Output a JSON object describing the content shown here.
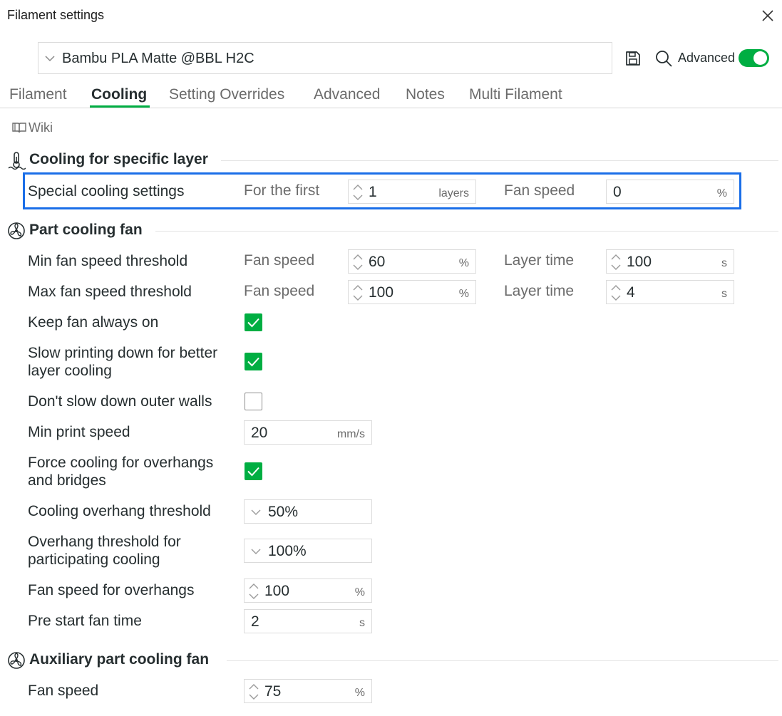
{
  "window": {
    "title": "Filament settings"
  },
  "preset": {
    "name": "Bambu PLA Matte @BBL H2C"
  },
  "toolbar": {
    "advanced_label": "Advanced",
    "advanced_on": true
  },
  "tabs": [
    {
      "label": "Filament",
      "active": false
    },
    {
      "label": "Cooling",
      "active": true
    },
    {
      "label": "Setting Overrides",
      "active": false
    },
    {
      "label": "Advanced",
      "active": false
    },
    {
      "label": "Notes",
      "active": false
    },
    {
      "label": "Multi Filament",
      "active": false
    }
  ],
  "wiki": {
    "label": "Wiki"
  },
  "sections": {
    "specific_layer": "Cooling for specific layer",
    "part_fan": "Part cooling fan",
    "aux_fan": "Auxiliary part cooling fan"
  },
  "special_cooling": {
    "label": "Special cooling settings",
    "for_first_label": "For the first",
    "layers_value": "1",
    "layers_unit": "layers",
    "fan_speed_label": "Fan speed",
    "fan_speed_value": "0",
    "fan_speed_unit": "%"
  },
  "min_fan": {
    "label": "Min fan speed threshold",
    "fan_speed_label": "Fan speed",
    "fan_speed_value": "60",
    "fan_speed_unit": "%",
    "layer_time_label": "Layer time",
    "layer_time_value": "100",
    "layer_time_unit": "s"
  },
  "max_fan": {
    "label": "Max fan speed threshold",
    "fan_speed_label": "Fan speed",
    "fan_speed_value": "100",
    "fan_speed_unit": "%",
    "layer_time_label": "Layer time",
    "layer_time_value": "4",
    "layer_time_unit": "s"
  },
  "keep_fan_on": {
    "label": "Keep fan always on",
    "checked": true
  },
  "slow_down": {
    "label_line1": "Slow printing down for better",
    "label_line2": "layer cooling",
    "checked": true
  },
  "dont_slow_outer": {
    "label": "Don't slow down outer walls",
    "checked": false
  },
  "min_print_speed": {
    "label": "Min print speed",
    "value": "20",
    "unit": "mm/s"
  },
  "force_cooling": {
    "label_line1": "Force cooling for overhangs",
    "label_line2": "and bridges",
    "checked": true
  },
  "overhang_threshold": {
    "label": "Cooling overhang threshold",
    "value": "50%"
  },
  "overhang_participating": {
    "label_line1": "Overhang threshold for",
    "label_line2": "participating cooling",
    "value": "100%"
  },
  "fan_speed_overhangs": {
    "label": "Fan speed for overhangs",
    "value": "100",
    "unit": "%"
  },
  "pre_start_fan": {
    "label": "Pre start fan time",
    "value": "2",
    "unit": "s"
  },
  "aux_fan_speed": {
    "label": "Fan speed",
    "value": "75",
    "unit": "%"
  },
  "colors": {
    "accent": "#00ae42",
    "highlight": "#1a6ee8",
    "text": "#262e30",
    "muted": "#6b6b6b"
  }
}
